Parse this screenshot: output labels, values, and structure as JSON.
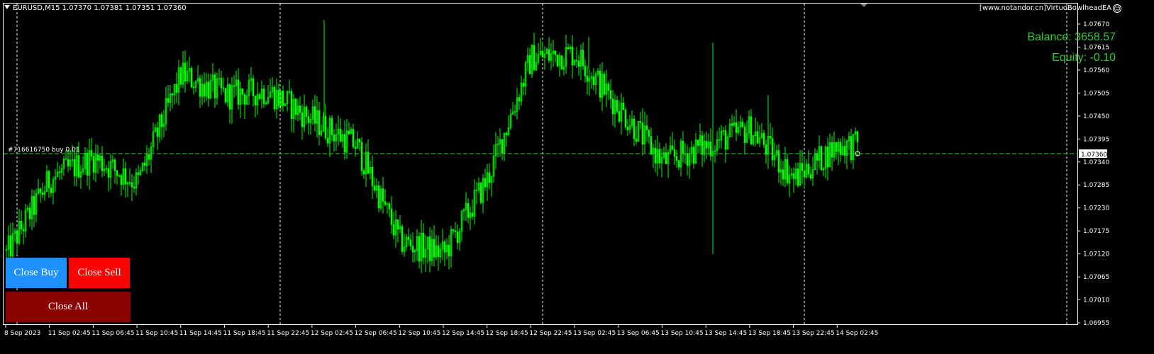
{
  "chart": {
    "symbol_header": "EURUSD,M15  1.07370 1.07381 1.07351 1.07360",
    "brand": "[www.notandor.cn]VirtuoBowlheadEA",
    "balance": "Balance: 3658.57",
    "equity": "Equity: -0.10",
    "position_label": "#716616750 buy 0.01",
    "current_price": "1.07360",
    "colors": {
      "background": "#000000",
      "candle": "#00ff00",
      "text": "#ffffff",
      "info": "#32cd32",
      "position_line": "#32cd32"
    }
  },
  "buttons": {
    "close_buy": "Close Buy",
    "close_sell": "Close Sell",
    "close_all": "Close All"
  },
  "chart_data": {
    "type": "candlestick",
    "ylim": [
      1.06955,
      1.07697
    ],
    "ytick_labels": [
      "1.07670",
      "1.07615",
      "1.07560",
      "1.07505",
      "1.07450",
      "1.07395",
      "1.07340",
      "1.07285",
      "1.07230",
      "1.07175",
      "1.07120",
      "1.07065",
      "1.07010",
      "1.06955"
    ],
    "xtick_labels": [
      "8 Sep 2023",
      "11 Sep 02:45",
      "11 Sep 06:45",
      "11 Sep 10:45",
      "11 Sep 14:45",
      "11 Sep 18:45",
      "11 Sep 22:45",
      "12 Sep 02:45",
      "12 Sep 06:45",
      "12 Sep 10:45",
      "12 Sep 14:45",
      "12 Sep 18:45",
      "12 Sep 22:45",
      "13 Sep 02:45",
      "13 Sep 06:45",
      "13 Sep 10:45",
      "13 Sep 14:45",
      "13 Sep 18:45",
      "13 Sep 22:45",
      "14 Sep 02:45"
    ],
    "position_price": 1.0736,
    "close_path": [
      [
        "8 Sep 2023",
        1.0712
      ],
      [
        "11 Sep 02:45",
        1.073
      ],
      [
        "11 Sep 06:45",
        1.0735
      ],
      [
        "11 Sep 10:45",
        1.0729
      ],
      [
        "11 Sep 14:45",
        1.0755
      ],
      [
        "11 Sep 18:45",
        1.075
      ],
      [
        "11 Sep 22:45",
        1.0751
      ],
      [
        "12 Sep 02:45",
        1.0744
      ],
      [
        "12 Sep 06:45",
        1.0738
      ],
      [
        "12 Sep 10:45",
        1.0715
      ],
      [
        "12 Sep 14:45",
        1.0712
      ],
      [
        "12 Sep 18:45",
        1.073
      ],
      [
        "12 Sep 22:45",
        1.0759
      ],
      [
        "13 Sep 02:45",
        1.076
      ],
      [
        "13 Sep 06:45",
        1.0747
      ],
      [
        "13 Sep 10:45",
        1.0734
      ],
      [
        "13 Sep 14:45",
        1.0738
      ],
      [
        "13 Sep 18:45",
        1.0742
      ],
      [
        "13 Sep 22:45",
        1.073
      ],
      [
        "14 Sep 02:45",
        1.0738
      ]
    ]
  }
}
